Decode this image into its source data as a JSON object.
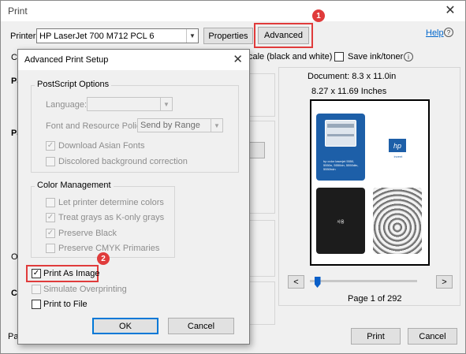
{
  "window": {
    "title": "Print",
    "printer_label": "Printer:",
    "printer_value": "HP LaserJet 700 M712 PCL 6",
    "properties_label": "Properties",
    "advanced_label": "Advanced",
    "help_label": "Help",
    "grayscale_partial": "cale (black and white)",
    "save_ink_label": "Save ink/toner",
    "print_label": "Print",
    "cancel_label": "Cancel",
    "left_edge_letters": [
      "C",
      "Pa",
      "Pa",
      "O",
      "Co",
      "Pa"
    ]
  },
  "preview": {
    "document_size": "Document: 8.3 x 11.0in",
    "page_size": "8.27 x 11.69 Inches",
    "page_indicator": "Page 1 of 292",
    "prev_glyph": "<",
    "next_glyph": ">",
    "slider_position": 0.07,
    "sample_text_cover": "hp color laserjet 5550, 5550n, 5550dn, 5550dtn, 5550hdn",
    "sample_text_dark": "사용",
    "sample_logo": "hp",
    "sample_brand": "invent"
  },
  "dialog": {
    "title": "Advanced Print Setup",
    "postscript": {
      "title": "PostScript Options",
      "language_label": "Language:",
      "language_value": "",
      "font_label": "Font and Resource Policy:",
      "font_value": "Send by Range",
      "download_asian_fonts": "Download Asian Fonts",
      "discolored_background": "Discolored background correction"
    },
    "color_management": {
      "title": "Color Management",
      "let_printer": "Let printer determine colors",
      "treat_grays": "Treat grays as K-only grays",
      "preserve_black": "Preserve Black",
      "preserve_cmyk": "Preserve CMYK Primaries"
    },
    "print_as_image": "Print As Image",
    "simulate_overprinting": "Simulate Overprinting",
    "print_to_file": "Print to File",
    "ok_label": "OK",
    "cancel_label": "Cancel"
  },
  "annotations": {
    "badge_1": "1",
    "badge_2": "2",
    "highlight_color": "#e03b3b"
  }
}
